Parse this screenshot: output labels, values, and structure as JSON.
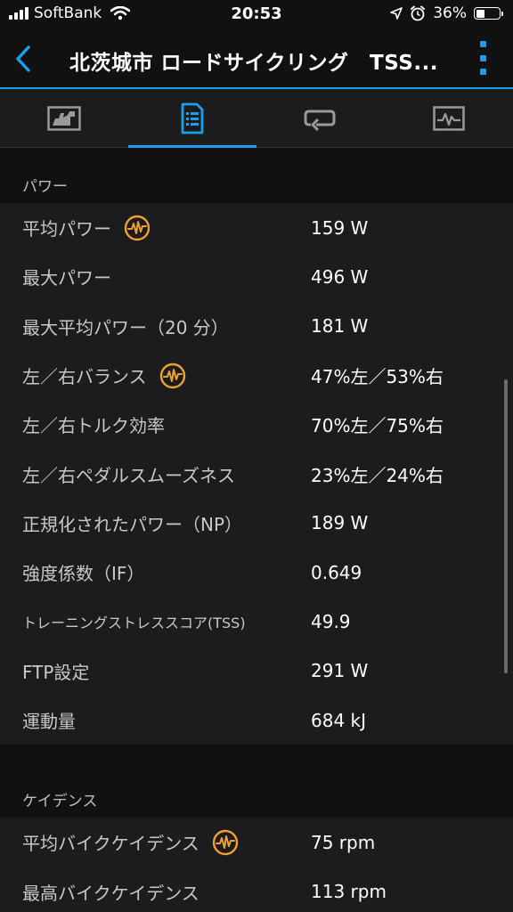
{
  "status_bar": {
    "carrier": "SoftBank",
    "time": "20:53",
    "battery": "36%",
    "battery_level": 0.36
  },
  "header": {
    "title": "北茨城市 ロードサイクリング　TSS...",
    "accent_color": "#1aa0e8"
  },
  "tabs": [
    {
      "icon": "summary-chart-icon",
      "active": false
    },
    {
      "icon": "stats-document-icon",
      "active": true
    },
    {
      "icon": "laps-icon",
      "active": false
    },
    {
      "icon": "graph-icon",
      "active": false
    }
  ],
  "sections": [
    {
      "title": "パワー",
      "rows": [
        {
          "label": "平均パワー",
          "value": "159 W",
          "badge": true
        },
        {
          "label": "最大パワー",
          "value": "496 W",
          "badge": false
        },
        {
          "label": "最大平均パワー（20 分）",
          "value": "181 W",
          "badge": false
        },
        {
          "label": "左／右バランス",
          "value": "47%左／53%右",
          "badge": true
        },
        {
          "label": "左／右トルク効率",
          "value": "70%左／75%右",
          "badge": false
        },
        {
          "label": "左／右ペダルスムーズネス",
          "value": "23%左／24%右",
          "badge": false
        },
        {
          "label": "正規化されたパワー（NP）",
          "value": "189 W",
          "badge": false
        },
        {
          "label": "強度係数（IF）",
          "value": "0.649",
          "badge": false
        },
        {
          "label": "トレーニングストレススコア(TSS)",
          "value": "49.9",
          "badge": false
        },
        {
          "label": "FTP設定",
          "value": "291 W",
          "badge": false
        },
        {
          "label": "運動量",
          "value": "684 kJ",
          "badge": false
        }
      ]
    },
    {
      "title": "ケイデンス",
      "rows": [
        {
          "label": "平均バイクケイデンス",
          "value": "75 rpm",
          "badge": true
        },
        {
          "label": "最高バイクケイデンス",
          "value": "113 rpm",
          "badge": false
        }
      ]
    }
  ],
  "badge_color": "#f0a030"
}
